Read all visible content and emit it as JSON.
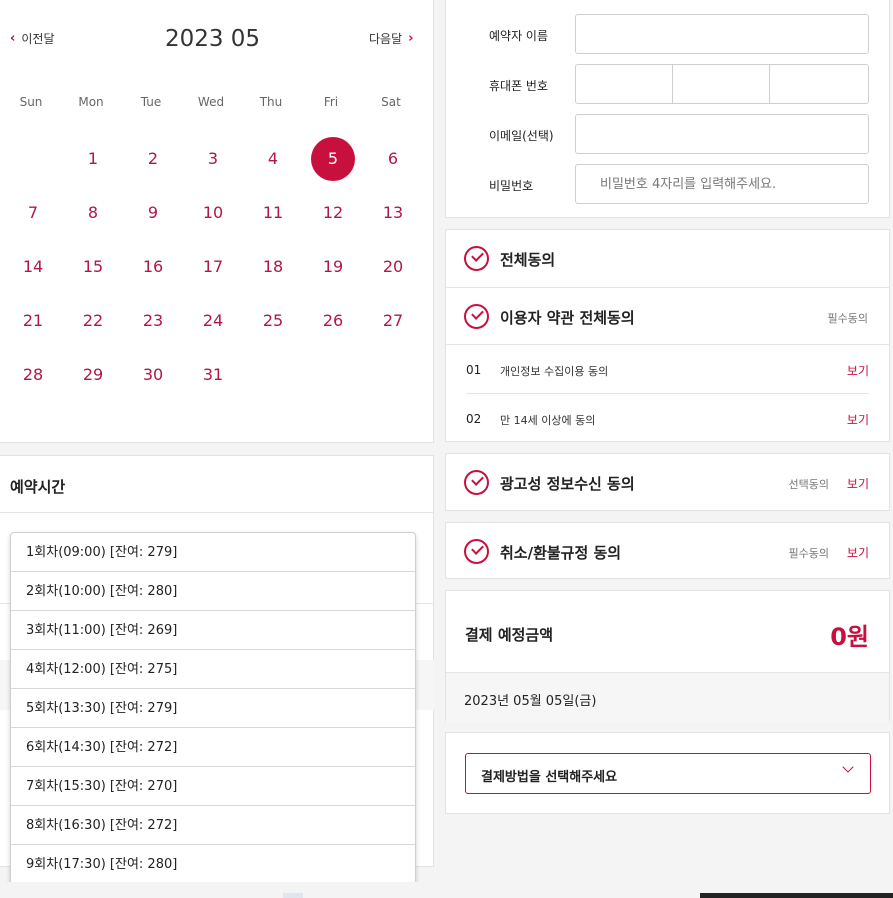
{
  "calendar": {
    "prev_label": "이전달",
    "next_label": "다음달",
    "title": "2023 05",
    "weekdays": [
      "Sun",
      "Mon",
      "Tue",
      "Wed",
      "Thu",
      "Fri",
      "Sat"
    ],
    "days": [
      "1",
      "2",
      "3",
      "4",
      "5",
      "6",
      "7",
      "8",
      "9",
      "10",
      "11",
      "12",
      "13",
      "14",
      "15",
      "16",
      "17",
      "18",
      "19",
      "20",
      "21",
      "22",
      "23",
      "24",
      "25",
      "26",
      "27",
      "28",
      "29",
      "30",
      "31"
    ],
    "first_weekday_index": 1,
    "selected_day": "5"
  },
  "time": {
    "title": "예약시간",
    "slots": [
      "1회차(09:00) [잔여: 279]",
      "2회차(10:00) [잔여: 280]",
      "3회차(11:00) [잔여: 269]",
      "4회차(12:00) [잔여: 275]",
      "5회차(13:30) [잔여: 279]",
      "6회차(14:30) [잔여: 272]",
      "7회차(15:30) [잔여: 270]",
      "8회차(16:30) [잔여: 272]",
      "9회차(17:30) [잔여: 280]"
    ]
  },
  "form": {
    "name_label": "예약자 이름",
    "phone_label": "휴대폰 번호",
    "email_label": "이메일(선택)",
    "password_label": "비밀번호",
    "password_placeholder": "비밀번호 4자리를 입력해주세요."
  },
  "agreements": {
    "all": "전체동의",
    "terms_title": "이용자 약관 전체동의",
    "required_tag": "필수동의",
    "optional_tag": "선택동의",
    "view_label": "보기",
    "terms_items": [
      {
        "num": "01",
        "text": "개인정보 수집이용 동의"
      },
      {
        "num": "02",
        "text": "만 14세 이상에 동의"
      }
    ],
    "ad_title": "광고성 정보수신 동의",
    "cancel_title": "취소/환불규정 동의"
  },
  "payment": {
    "label": "결제 예정금액",
    "amount": "0원",
    "date": "2023년 05월 05일(금)",
    "method_placeholder": "결제방법을 선택해주세요"
  },
  "colors": {
    "accent": "#c8103f",
    "day_text": "#b01745"
  }
}
